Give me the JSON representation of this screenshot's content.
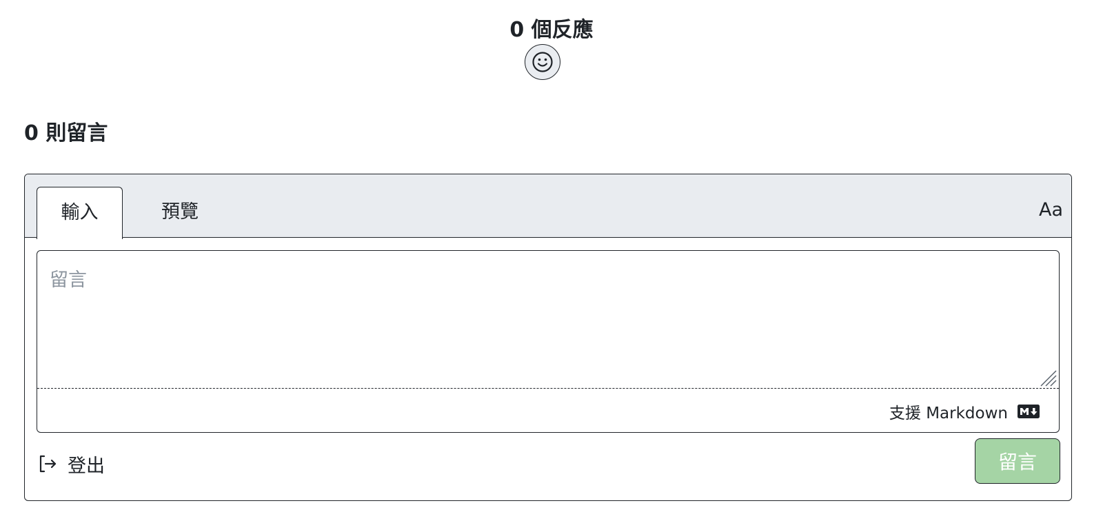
{
  "reactions": {
    "title": "0 個反應",
    "add_reaction_icon": "smiley-icon"
  },
  "comments": {
    "title": "0 則留言"
  },
  "editor": {
    "tabs": [
      {
        "label": "輸入",
        "active": true
      },
      {
        "label": "預覽",
        "active": false
      }
    ],
    "font_toggle": "Aa",
    "placeholder": "留言",
    "value": "",
    "markdown_hint": "支援 Markdown",
    "markdown_icon": "markdown-icon",
    "resize_icon": "resize-handle-icon"
  },
  "footer": {
    "logout_label": "登出",
    "logout_icon": "sign-out-icon",
    "submit_label": "留言"
  },
  "colors": {
    "header_bg": "#e9ecf0",
    "border": "#1f2328",
    "placeholder": "#8c959f",
    "submit_disabled_bg": "#a5d4a5",
    "submit_text": "#ffffff"
  }
}
